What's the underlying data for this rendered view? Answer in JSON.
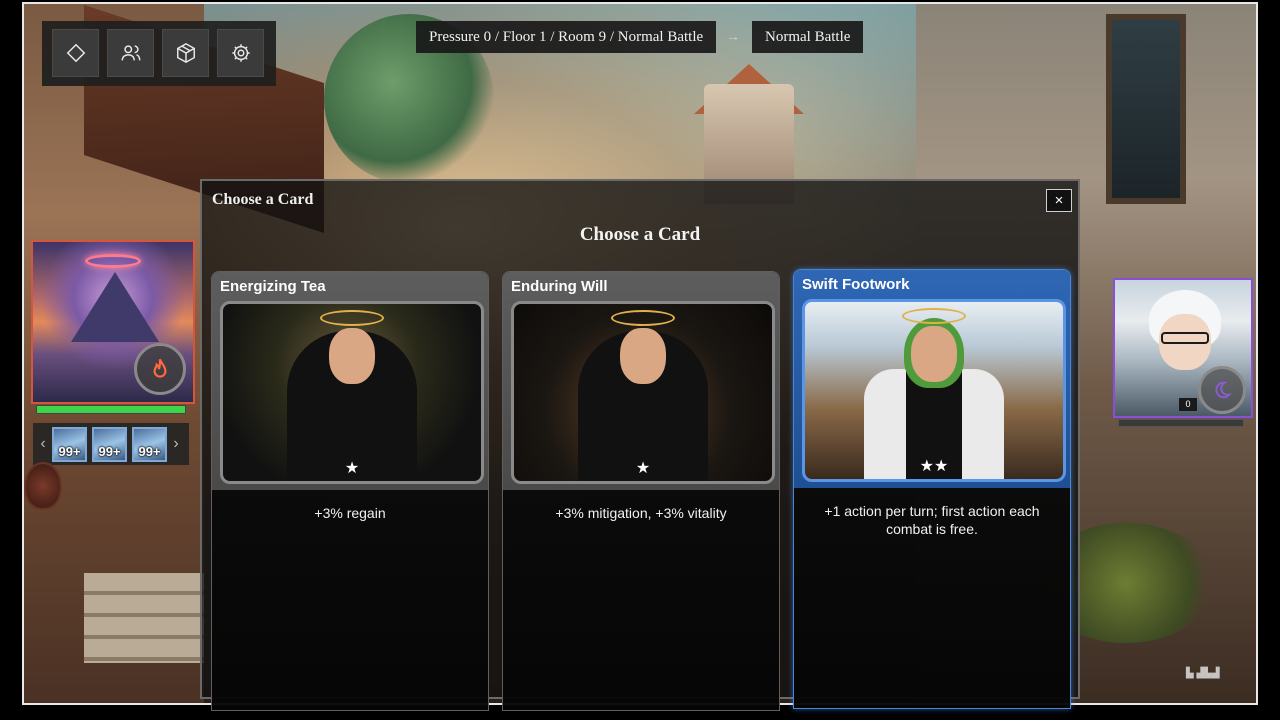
{
  "toolbar": {
    "buttons": [
      {
        "icon": "diamond-icon"
      },
      {
        "icon": "users-icon"
      },
      {
        "icon": "box-icon"
      },
      {
        "icon": "gear-icon"
      }
    ]
  },
  "breadcrumb": {
    "path": "Pressure 0 / Floor 1 / Room 9 / Normal Battle",
    "arrow": "→",
    "next": "Normal Battle"
  },
  "player": {
    "hp_fraction": 1.0,
    "element_icon": "fire-icon",
    "inventory_prev": "‹",
    "inventory_next": "›",
    "items": [
      {
        "count": "99+"
      },
      {
        "count": "99+"
      },
      {
        "count": "99+"
      }
    ]
  },
  "foe": {
    "counter": "0",
    "element_icon": "moon-icon",
    "hp_fraction": 0
  },
  "modal": {
    "header": "Choose a Card",
    "close_label": "×",
    "title": "Choose a Card",
    "cards": [
      {
        "name": "Energizing Tea",
        "stars": "★",
        "description": "+3% regain",
        "selected": false
      },
      {
        "name": "Enduring Will",
        "stars": "★",
        "description": "+3% mitigation, +3% vitality",
        "selected": false
      },
      {
        "name": "Swift Footwork",
        "stars": "★★",
        "description": "+1 action per turn; first action each combat is free.",
        "selected": true
      }
    ]
  },
  "colors": {
    "accent_selected": "#2f67b5",
    "hp": "#3fd44a",
    "player_border": "#d9553a",
    "foe_border": "#8a4ed8"
  }
}
